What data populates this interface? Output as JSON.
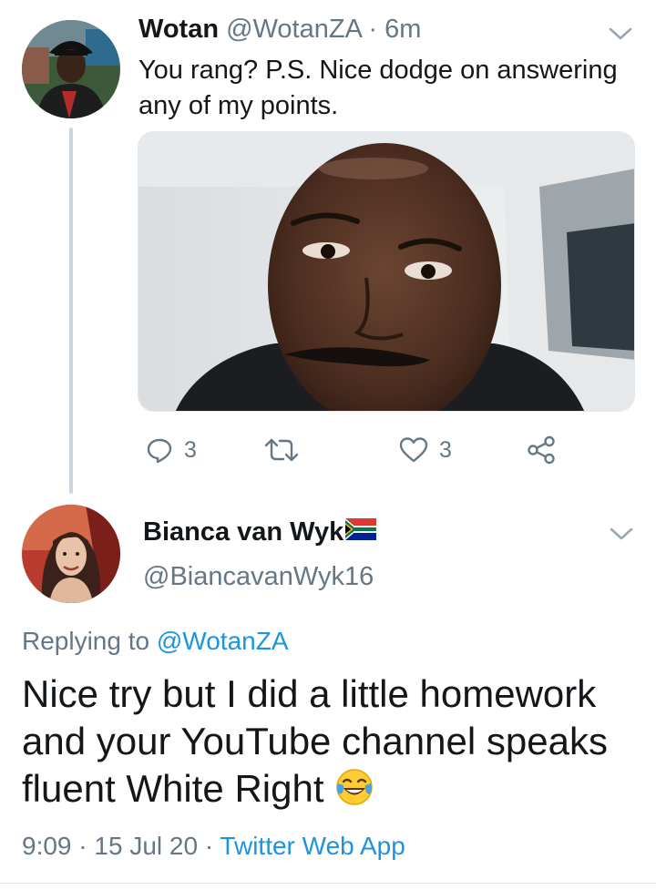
{
  "tweet1": {
    "name": "Wotan",
    "handle": "@WotanZA",
    "separator": "·",
    "time": "6m",
    "text": "You rang? P.S. Nice dodge on answering any  of my points.",
    "actions": {
      "reply_count": "3",
      "like_count": "3"
    }
  },
  "tweet2": {
    "name": "Bianca van Wyk",
    "handle": "@BiancavanWyk16",
    "replying_prefix": "Replying to",
    "replying_mention": "@WotanZA",
    "text": "Nice try but I did a little homework and your YouTube channel speaks fluent White Right",
    "meta_time": "9:09",
    "meta_sep1": "·",
    "meta_date": "15 Jul 20",
    "meta_sep2": "·",
    "meta_source": "Twitter Web App"
  },
  "colors": {
    "text": "#14171a",
    "secondary": "#657786",
    "link": "#1b95e0",
    "thread_line": "#cdd5db"
  },
  "icons": {
    "caret": "chevron-down-icon",
    "reply": "reply-icon",
    "retweet": "retweet-icon",
    "like": "heart-icon",
    "share": "share-icon",
    "flag": "south-africa-flag-icon",
    "emoji": "tears-of-joy-emoji-icon"
  }
}
